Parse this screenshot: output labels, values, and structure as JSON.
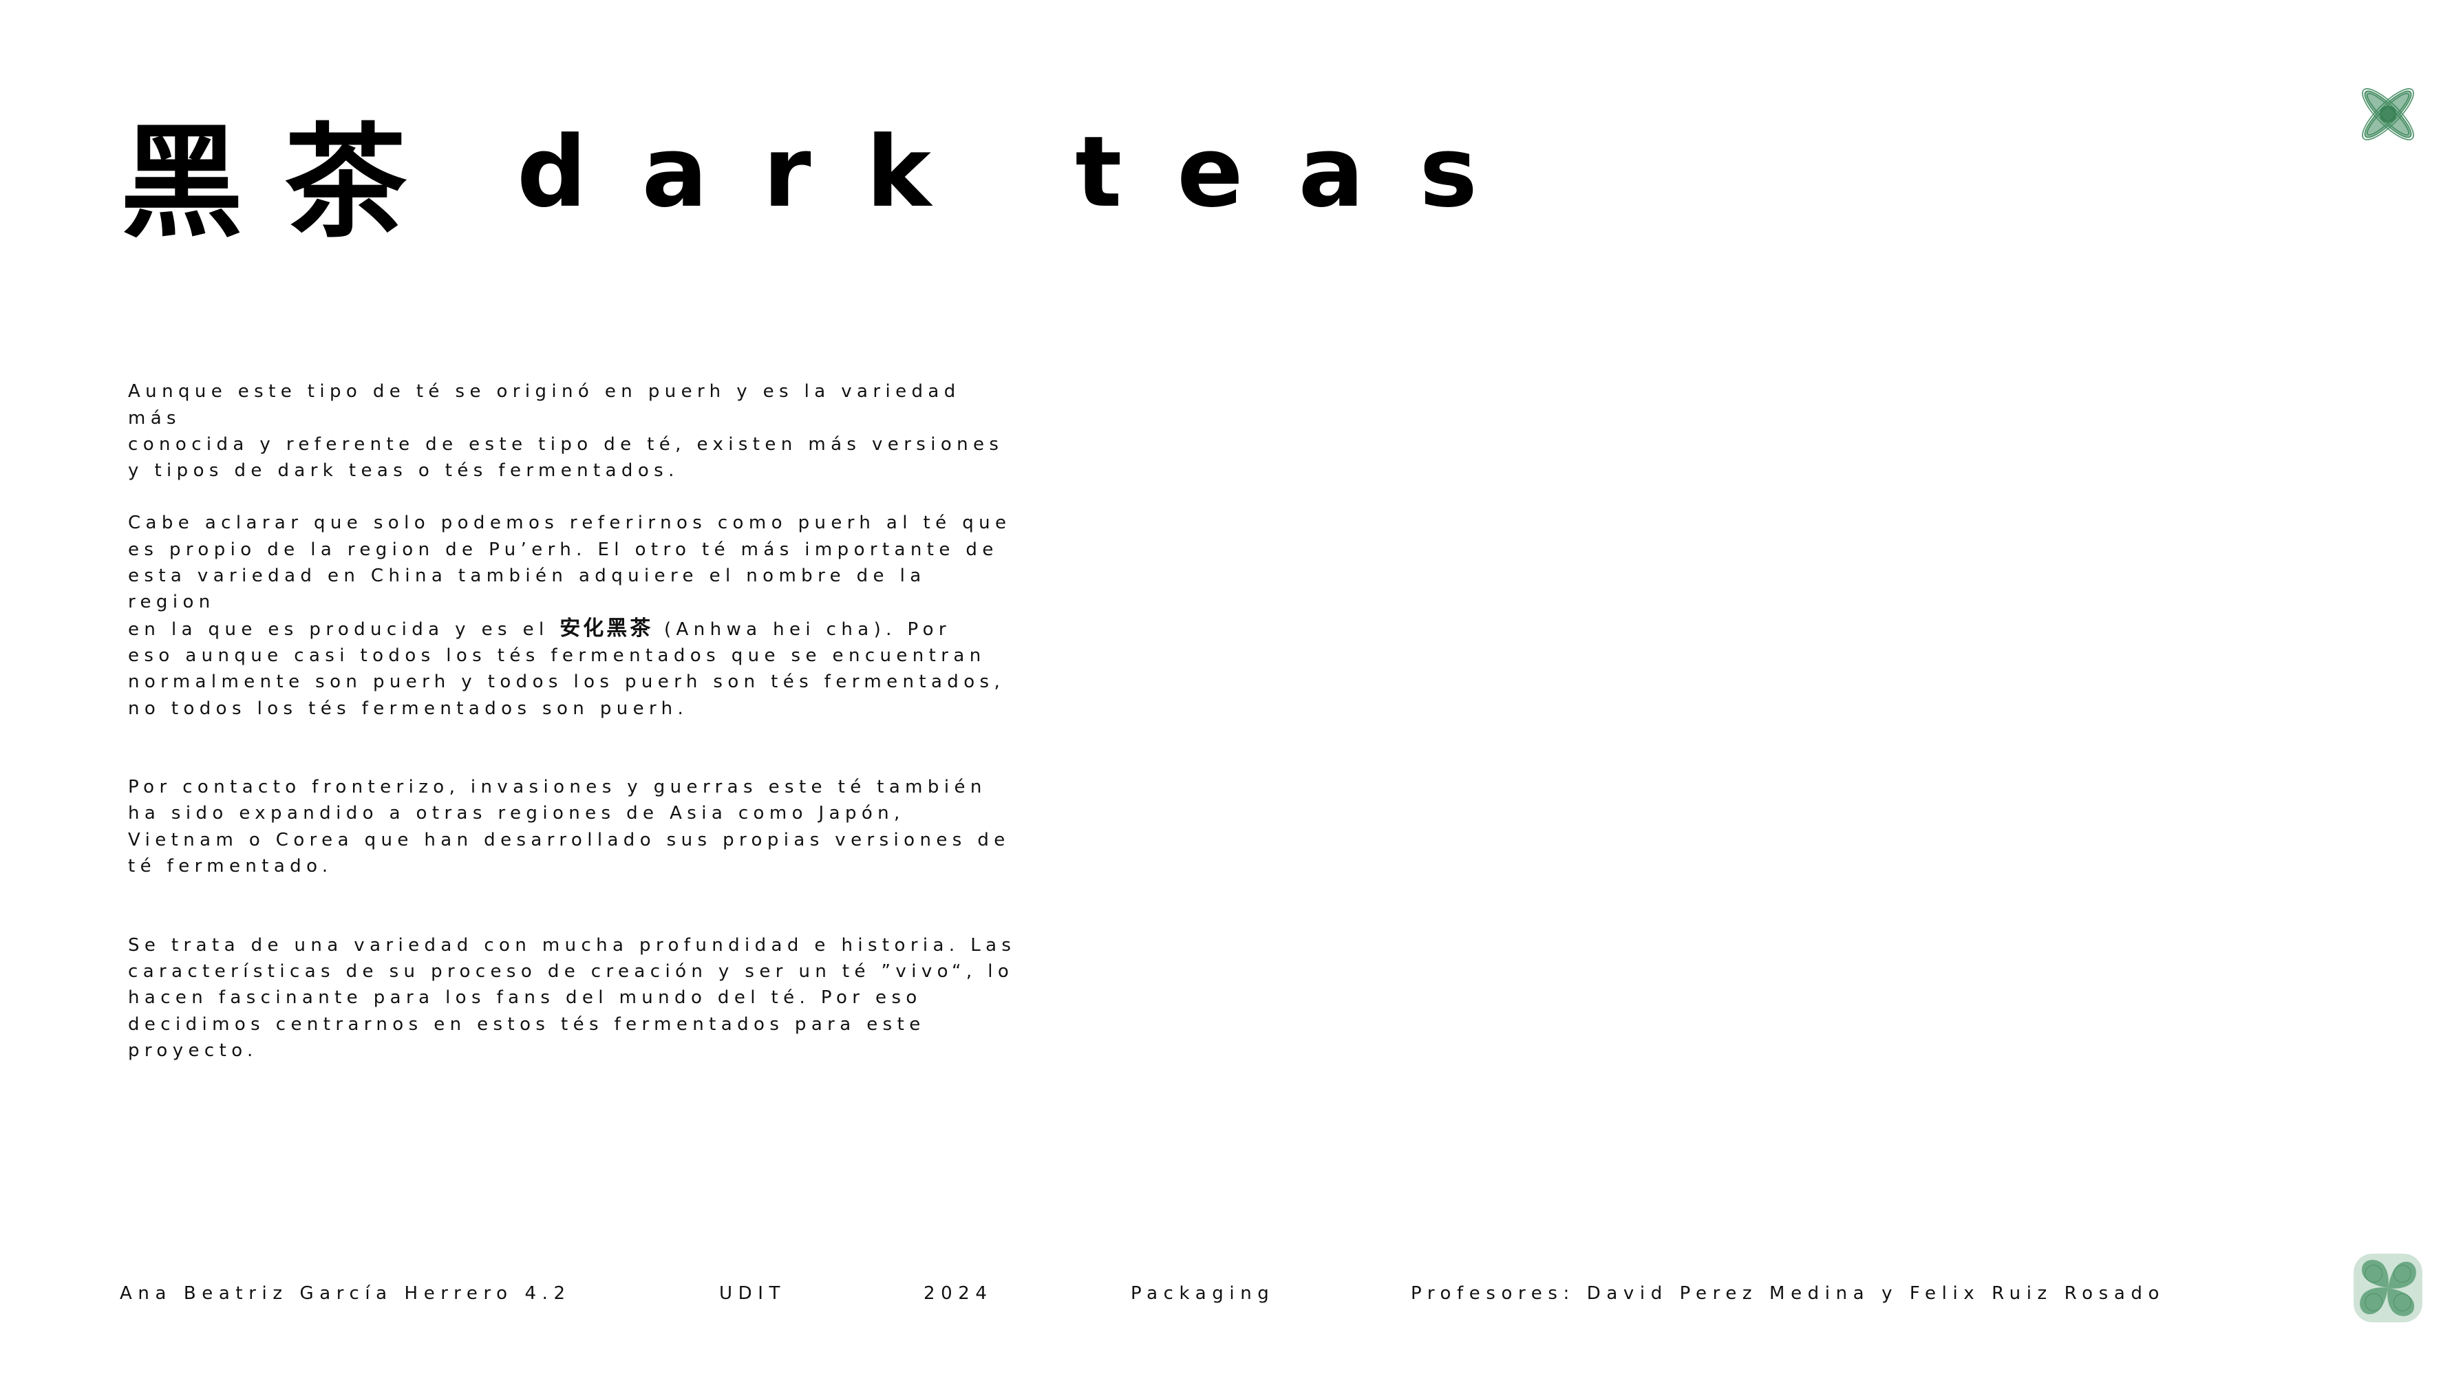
{
  "title": {
    "cjk": "黑茶",
    "latin": "dark teas"
  },
  "paragraphs": [
    {
      "segments": [
        "Aunque este tipo de té se originó en puerh y es la variedad más\nconocida y referente de este tipo de té, existen más versiones\ny tipos de dark teas o tés fermentados."
      ]
    },
    {
      "segments": [
        "Cabe aclarar que solo podemos referirnos como puerh al té que\nes propio de la region de Pu’erh. El otro té más importante de\nesta variedad en China también adquiere el nombre de la region\nen la que es producida y es el ",
        "安化黑茶",
        " (Anhwa hei cha). Por\neso aunque casi todos los tés fermentados que se encuentran\nnormalmente son puerh y todos los puerh son tés fermentados,\nno todos los tés fermentados son puerh."
      ]
    },
    {
      "segments": [
        "Por contacto fronterizo, invasiones y guerras este té también\nha sido expandido a otras regiones de Asia como Japón,\nVietnam o Corea que han desarrollado sus propias versiones de\nté fermentado."
      ]
    },
    {
      "segments": [
        "Se trata de una variedad con mucha profundidad e historia. Las\ncaracterísticas de su proceso de creación y ser un té ”vivo“, lo\nhacen fascinante para los fans del mundo del té. Por eso\ndecidimos centrarnos en estos tés fermentados para este\nproyecto."
      ]
    }
  ],
  "footer": {
    "author": "Ana Beatriz García Herrero 4.2",
    "school": "UDIT",
    "year": "2024",
    "subject": "Packaging",
    "professors": "Profesores: David Perez Medina y  Felix Ruiz Rosado"
  },
  "decorations": {
    "top_right": "x-knot-icon",
    "bottom_right": "clover-tile-icon",
    "accent_color": "#3f8a5e"
  }
}
